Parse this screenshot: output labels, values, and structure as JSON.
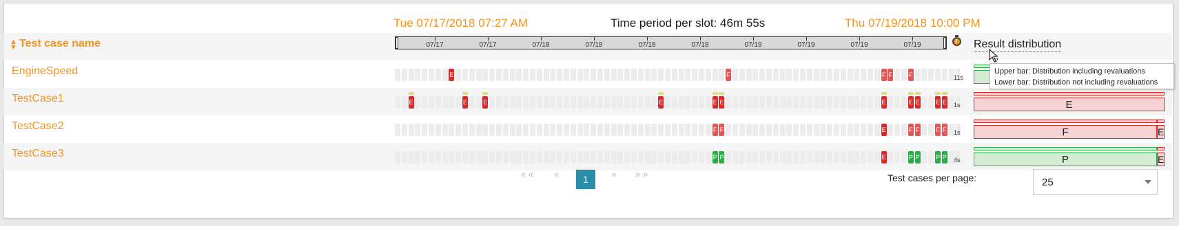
{
  "header": {
    "start": "Tue 07/17/2018 07:27 AM",
    "period": "Time period per slot: 46m 55s",
    "end": "Thu 07/19/2018 10:00 PM"
  },
  "columns": {
    "test_case_name": "Test case name",
    "result_distribution": "Result distribution"
  },
  "timeline_labels": [
    "07/17",
    "07/17",
    "07/18",
    "07/18",
    "07/18",
    "07/18",
    "07/19",
    "07/19",
    "07/19",
    "07/19"
  ],
  "tooltip": {
    "line1": "Upper bar: Distribution including revaluations",
    "line2": "Lower bar: Distribution not including revaluations"
  },
  "rows": [
    {
      "name": "EngineSpeed",
      "duration": "11s",
      "marks": [
        {
          "i": 8,
          "s": "E",
          "t": "E"
        },
        {
          "i": 49,
          "s": "F",
          "t": "F"
        },
        {
          "i": 72,
          "s": "F",
          "t": "F"
        },
        {
          "i": 73,
          "s": "F",
          "t": "F"
        },
        {
          "i": 76,
          "s": "F",
          "t": "F"
        }
      ],
      "ups": [],
      "dist": {
        "label": "",
        "main": "P",
        "main_fraction": 1.0
      }
    },
    {
      "name": "TestCase1",
      "duration": "1s",
      "marks": [
        {
          "i": 2,
          "s": "E",
          "t": "E"
        },
        {
          "i": 10,
          "s": "E",
          "t": "E"
        },
        {
          "i": 13,
          "s": "E",
          "t": "E"
        },
        {
          "i": 39,
          "s": "E",
          "t": "E"
        },
        {
          "i": 47,
          "s": "E",
          "t": "E"
        },
        {
          "i": 48,
          "s": "E",
          "t": "E"
        },
        {
          "i": 72,
          "s": "E",
          "t": "E"
        },
        {
          "i": 76,
          "s": "E",
          "t": "E"
        },
        {
          "i": 77,
          "s": "E",
          "t": "E"
        },
        {
          "i": 80,
          "s": "E",
          "t": "E"
        },
        {
          "i": 81,
          "s": "E",
          "t": "E"
        }
      ],
      "ups": [
        2,
        10,
        13,
        39,
        47,
        48,
        72,
        76,
        77,
        80,
        81
      ],
      "dist": {
        "label": "E",
        "main": "E",
        "main_fraction": 1.0
      }
    },
    {
      "name": "TestCase2",
      "duration": "1s",
      "marks": [
        {
          "i": 47,
          "s": "F",
          "t": "F"
        },
        {
          "i": 48,
          "s": "F",
          "t": "F"
        },
        {
          "i": 72,
          "s": "E",
          "t": "E"
        },
        {
          "i": 76,
          "s": "F",
          "t": "F"
        },
        {
          "i": 77,
          "s": "F",
          "t": "F"
        },
        {
          "i": 80,
          "s": "F",
          "t": "F"
        },
        {
          "i": 81,
          "s": "F",
          "t": "F"
        }
      ],
      "ups": [],
      "dist": {
        "label": "F",
        "main": "F",
        "main_fraction": 0.96,
        "rest_label": "E"
      }
    },
    {
      "name": "TestCase3",
      "duration": "4s",
      "marks": [
        {
          "i": 47,
          "s": "P",
          "t": "P"
        },
        {
          "i": 48,
          "s": "P",
          "t": "P"
        },
        {
          "i": 72,
          "s": "E",
          "t": "E"
        },
        {
          "i": 76,
          "s": "P",
          "t": "P"
        },
        {
          "i": 77,
          "s": "P",
          "t": "P"
        },
        {
          "i": 80,
          "s": "P",
          "t": "P"
        },
        {
          "i": 81,
          "s": "P",
          "t": "P"
        }
      ],
      "ups": [],
      "dist": {
        "label": "P",
        "main": "P",
        "main_fraction": 0.96,
        "rest_label": "E"
      }
    }
  ],
  "pagination": {
    "first": "« «",
    "prev": "«",
    "current": "1",
    "next": "»",
    "last": "» »"
  },
  "per_page": {
    "label": "Test cases per page:",
    "value": "25"
  },
  "colors": {
    "accent": "#f7941d",
    "error": "#d62a2a",
    "fail": "#e05757",
    "pass": "#2faa4a",
    "page_active": "#2b8ea9"
  }
}
